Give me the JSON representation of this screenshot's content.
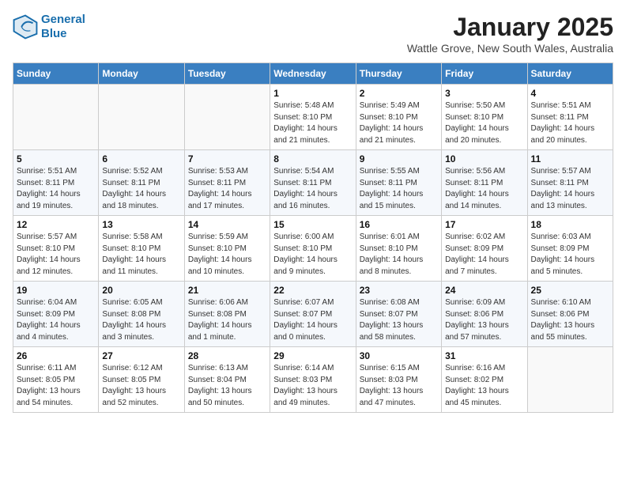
{
  "header": {
    "logo_line1": "General",
    "logo_line2": "Blue",
    "month_year": "January 2025",
    "location": "Wattle Grove, New South Wales, Australia"
  },
  "weekdays": [
    "Sunday",
    "Monday",
    "Tuesday",
    "Wednesday",
    "Thursday",
    "Friday",
    "Saturday"
  ],
  "weeks": [
    [
      {
        "day": "",
        "info": ""
      },
      {
        "day": "",
        "info": ""
      },
      {
        "day": "",
        "info": ""
      },
      {
        "day": "1",
        "info": "Sunrise: 5:48 AM\nSunset: 8:10 PM\nDaylight: 14 hours\nand 21 minutes."
      },
      {
        "day": "2",
        "info": "Sunrise: 5:49 AM\nSunset: 8:10 PM\nDaylight: 14 hours\nand 21 minutes."
      },
      {
        "day": "3",
        "info": "Sunrise: 5:50 AM\nSunset: 8:10 PM\nDaylight: 14 hours\nand 20 minutes."
      },
      {
        "day": "4",
        "info": "Sunrise: 5:51 AM\nSunset: 8:11 PM\nDaylight: 14 hours\nand 20 minutes."
      }
    ],
    [
      {
        "day": "5",
        "info": "Sunrise: 5:51 AM\nSunset: 8:11 PM\nDaylight: 14 hours\nand 19 minutes."
      },
      {
        "day": "6",
        "info": "Sunrise: 5:52 AM\nSunset: 8:11 PM\nDaylight: 14 hours\nand 18 minutes."
      },
      {
        "day": "7",
        "info": "Sunrise: 5:53 AM\nSunset: 8:11 PM\nDaylight: 14 hours\nand 17 minutes."
      },
      {
        "day": "8",
        "info": "Sunrise: 5:54 AM\nSunset: 8:11 PM\nDaylight: 14 hours\nand 16 minutes."
      },
      {
        "day": "9",
        "info": "Sunrise: 5:55 AM\nSunset: 8:11 PM\nDaylight: 14 hours\nand 15 minutes."
      },
      {
        "day": "10",
        "info": "Sunrise: 5:56 AM\nSunset: 8:11 PM\nDaylight: 14 hours\nand 14 minutes."
      },
      {
        "day": "11",
        "info": "Sunrise: 5:57 AM\nSunset: 8:11 PM\nDaylight: 14 hours\nand 13 minutes."
      }
    ],
    [
      {
        "day": "12",
        "info": "Sunrise: 5:57 AM\nSunset: 8:10 PM\nDaylight: 14 hours\nand 12 minutes."
      },
      {
        "day": "13",
        "info": "Sunrise: 5:58 AM\nSunset: 8:10 PM\nDaylight: 14 hours\nand 11 minutes."
      },
      {
        "day": "14",
        "info": "Sunrise: 5:59 AM\nSunset: 8:10 PM\nDaylight: 14 hours\nand 10 minutes."
      },
      {
        "day": "15",
        "info": "Sunrise: 6:00 AM\nSunset: 8:10 PM\nDaylight: 14 hours\nand 9 minutes."
      },
      {
        "day": "16",
        "info": "Sunrise: 6:01 AM\nSunset: 8:10 PM\nDaylight: 14 hours\nand 8 minutes."
      },
      {
        "day": "17",
        "info": "Sunrise: 6:02 AM\nSunset: 8:09 PM\nDaylight: 14 hours\nand 7 minutes."
      },
      {
        "day": "18",
        "info": "Sunrise: 6:03 AM\nSunset: 8:09 PM\nDaylight: 14 hours\nand 5 minutes."
      }
    ],
    [
      {
        "day": "19",
        "info": "Sunrise: 6:04 AM\nSunset: 8:09 PM\nDaylight: 14 hours\nand 4 minutes."
      },
      {
        "day": "20",
        "info": "Sunrise: 6:05 AM\nSunset: 8:08 PM\nDaylight: 14 hours\nand 3 minutes."
      },
      {
        "day": "21",
        "info": "Sunrise: 6:06 AM\nSunset: 8:08 PM\nDaylight: 14 hours\nand 1 minute."
      },
      {
        "day": "22",
        "info": "Sunrise: 6:07 AM\nSunset: 8:07 PM\nDaylight: 14 hours\nand 0 minutes."
      },
      {
        "day": "23",
        "info": "Sunrise: 6:08 AM\nSunset: 8:07 PM\nDaylight: 13 hours\nand 58 minutes."
      },
      {
        "day": "24",
        "info": "Sunrise: 6:09 AM\nSunset: 8:06 PM\nDaylight: 13 hours\nand 57 minutes."
      },
      {
        "day": "25",
        "info": "Sunrise: 6:10 AM\nSunset: 8:06 PM\nDaylight: 13 hours\nand 55 minutes."
      }
    ],
    [
      {
        "day": "26",
        "info": "Sunrise: 6:11 AM\nSunset: 8:05 PM\nDaylight: 13 hours\nand 54 minutes."
      },
      {
        "day": "27",
        "info": "Sunrise: 6:12 AM\nSunset: 8:05 PM\nDaylight: 13 hours\nand 52 minutes."
      },
      {
        "day": "28",
        "info": "Sunrise: 6:13 AM\nSunset: 8:04 PM\nDaylight: 13 hours\nand 50 minutes."
      },
      {
        "day": "29",
        "info": "Sunrise: 6:14 AM\nSunset: 8:03 PM\nDaylight: 13 hours\nand 49 minutes."
      },
      {
        "day": "30",
        "info": "Sunrise: 6:15 AM\nSunset: 8:03 PM\nDaylight: 13 hours\nand 47 minutes."
      },
      {
        "day": "31",
        "info": "Sunrise: 6:16 AM\nSunset: 8:02 PM\nDaylight: 13 hours\nand 45 minutes."
      },
      {
        "day": "",
        "info": ""
      }
    ]
  ]
}
